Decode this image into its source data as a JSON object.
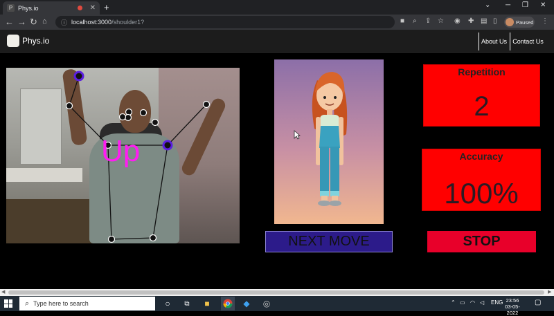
{
  "browser": {
    "tab_title": "Phys.io",
    "new_tab": "+",
    "url_host": "localhost:3000",
    "url_path": "/shoulder1?",
    "profile_status": "Paused"
  },
  "app": {
    "brand": "Phys.io",
    "nav": [
      {
        "label": "About Us"
      },
      {
        "label": "Contact Us"
      }
    ]
  },
  "exercise": {
    "pose_label": "Up",
    "next_label": "NEXT MOVE",
    "stop_label": "STOP"
  },
  "stats": {
    "repetition_title": "Repetition",
    "repetition_value": "2",
    "accuracy_title": "Accuracy",
    "accuracy_value": "100%"
  },
  "taskbar": {
    "search_placeholder": "Type here to search",
    "language": "ENG",
    "time": "23:56",
    "date": "03-05-2022"
  },
  "colors": {
    "stat_box": "#ff0000",
    "stop_button": "#e8002a",
    "next_button": "#2c1b8a",
    "pose_label": "#ff1cf2",
    "keypoint_highlight": "#5b1ee0"
  },
  "icons": [
    "back-icon",
    "forward-icon",
    "reload-icon",
    "home-icon",
    "lock-icon",
    "camera-icon",
    "zoom-icon",
    "share-icon",
    "star-icon",
    "extension-icon",
    "sidebar-icon",
    "menu-icon",
    "windows-start-icon",
    "search-icon",
    "task-view-icon",
    "file-explorer-icon",
    "chrome-icon",
    "vscode-icon",
    "app-icon",
    "wifi-icon",
    "volume-icon",
    "battery-icon",
    "notification-icon",
    "cursor-icon"
  ]
}
